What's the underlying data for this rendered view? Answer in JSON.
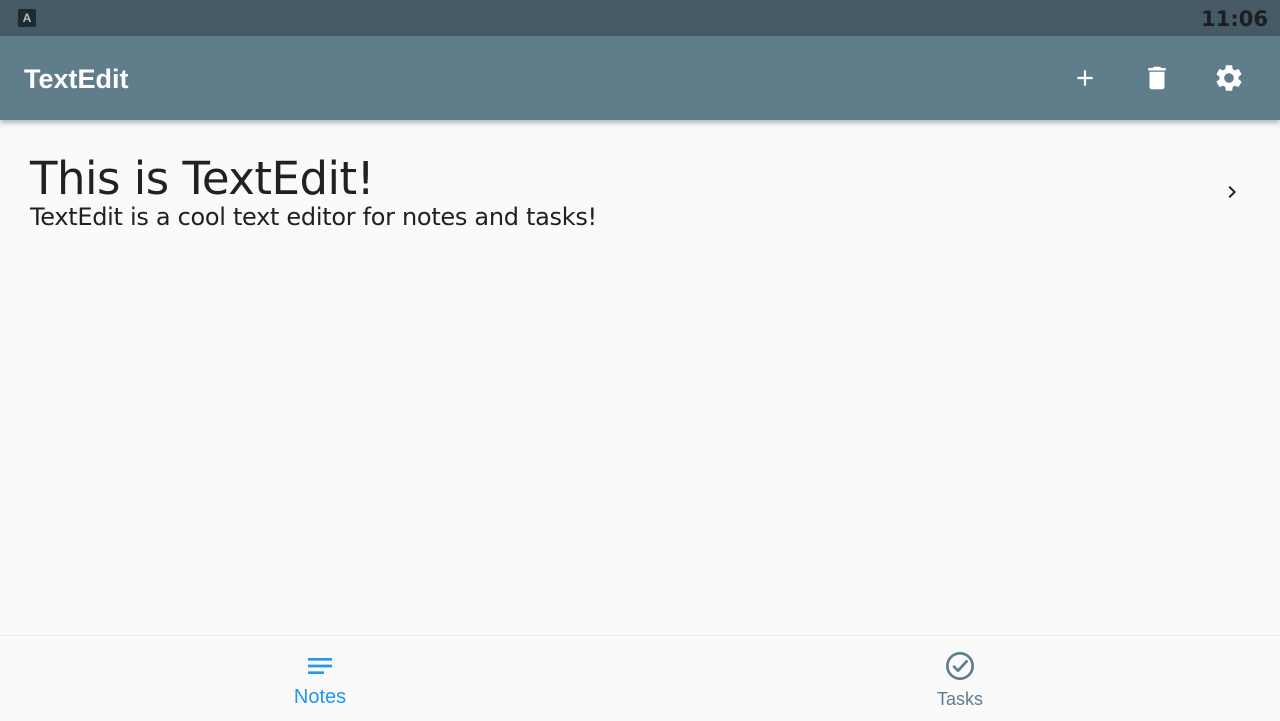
{
  "status_bar": {
    "app_icon_letter": "A",
    "time": "11:06"
  },
  "app_bar": {
    "title": "TextEdit",
    "actions": [
      {
        "icon": "plus-icon"
      },
      {
        "icon": "trash-icon"
      },
      {
        "icon": "gear-icon"
      }
    ]
  },
  "notes": [
    {
      "title": "This is TextEdit!",
      "body": "TextEdit is a cool text editor for notes and tasks!"
    }
  ],
  "bottom_nav": {
    "items": [
      {
        "label": "Notes",
        "icon": "notes-icon",
        "selected": true
      },
      {
        "label": "Tasks",
        "icon": "check-circle-icon",
        "selected": false
      }
    ]
  },
  "colors": {
    "status_bar": "#455a64",
    "app_bar": "#607d8b",
    "accent": "#2196f3",
    "nav_inactive": "#607d8b",
    "text": "#212121",
    "background": "#fafafa"
  }
}
